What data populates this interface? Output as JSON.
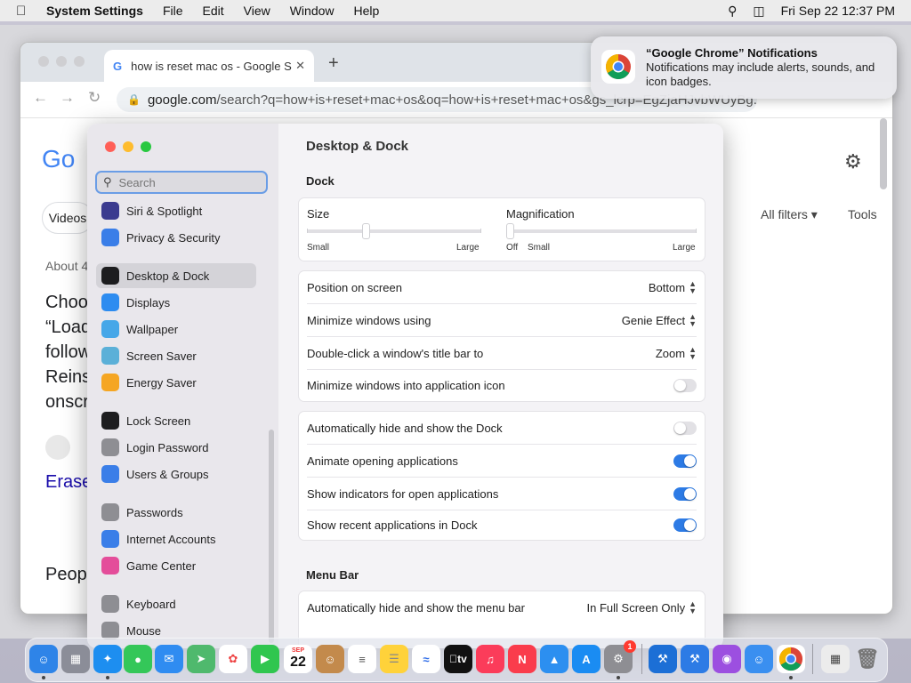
{
  "menubar": {
    "app": "System Settings",
    "items": [
      "File",
      "Edit",
      "View",
      "Window",
      "Help"
    ],
    "clock": "Fri Sep 22  12:37 PM"
  },
  "chrome": {
    "tab_title": "how is reset mac os - Google S",
    "url_host": "google.com",
    "url_path": "/search?q=how+is+reset+mac+os&oq=how+is+reset+mac+os&gs_lcrp=EgZjaHJvbWUyBg...",
    "filters": "All filters",
    "tools": "Tools",
    "videos": "Videos",
    "about": "About 4",
    "snippet": [
      "Choo",
      "“Load",
      "follow",
      "Reins",
      "onscr"
    ],
    "erase": "Erase",
    "people": "Peop"
  },
  "notification": {
    "title": "“Google Chrome” Notifications",
    "body": "Notifications may include alerts, sounds, and icon badges."
  },
  "settings": {
    "search_placeholder": "Search",
    "sidebar": [
      {
        "label": "Siri & Spotlight",
        "color": "#3b3b8f",
        "icon": "siri-icon"
      },
      {
        "label": "Privacy & Security",
        "color": "#3a7ee8",
        "icon": "hand-icon"
      },
      {
        "label": "Desktop & Dock",
        "color": "#1d1d1f",
        "icon": "dock-icon",
        "selected": true
      },
      {
        "label": "Displays",
        "color": "#2d8cf0",
        "icon": "sun-icon"
      },
      {
        "label": "Wallpaper",
        "color": "#46a7e8",
        "icon": "flower-icon"
      },
      {
        "label": "Screen Saver",
        "color": "#5bb0d8",
        "icon": "screensaver-icon"
      },
      {
        "label": "Energy Saver",
        "color": "#f5a623",
        "icon": "bulb-icon"
      },
      {
        "label": "Lock Screen",
        "color": "#1d1d1f",
        "icon": "lock-icon"
      },
      {
        "label": "Login Password",
        "color": "#8e8e93",
        "icon": "key-icon"
      },
      {
        "label": "Users & Groups",
        "color": "#3a7ee8",
        "icon": "users-icon"
      },
      {
        "label": "Passwords",
        "color": "#8e8e93",
        "icon": "key-icon"
      },
      {
        "label": "Internet Accounts",
        "color": "#3a7ee8",
        "icon": "at-icon"
      },
      {
        "label": "Game Center",
        "color": "#e44d9a",
        "icon": "gamecenter-icon"
      },
      {
        "label": "Keyboard",
        "color": "#8e8e93",
        "icon": "keyboard-icon"
      },
      {
        "label": "Mouse",
        "color": "#8e8e93",
        "icon": "mouse-icon"
      }
    ],
    "title": "Desktop & Dock",
    "dock_header": "Dock",
    "size_label": "Size",
    "size_small": "Small",
    "size_large": "Large",
    "size_value": 0.33,
    "mag_label": "Magnification",
    "mag_off": "Off",
    "mag_small": "Small",
    "mag_large": "Large",
    "mag_value": 0.0,
    "position_label": "Position on screen",
    "position_value": "Bottom",
    "minimize_label": "Minimize windows using",
    "minimize_value": "Genie Effect",
    "doubleclick_label": "Double-click a window's title bar to",
    "doubleclick_value": "Zoom",
    "minimize_icon_label": "Minimize windows into application icon",
    "autohide_label": "Automatically hide and show the Dock",
    "animate_label": "Animate opening applications",
    "indicators_label": "Show indicators for open applications",
    "recent_label": "Show recent applications in Dock",
    "menubar_header": "Menu Bar",
    "menubar_autohide_label": "Automatically hide and show the menu bar",
    "menubar_autohide_value": "In Full Screen Only",
    "toggles": {
      "minimize_icon": false,
      "autohide": false,
      "animate": true,
      "indicators": true,
      "recent": true
    }
  },
  "dock": {
    "calendar_month": "SEP",
    "calendar_day": "22",
    "tv_label": "tv",
    "settings_badge": "1"
  }
}
